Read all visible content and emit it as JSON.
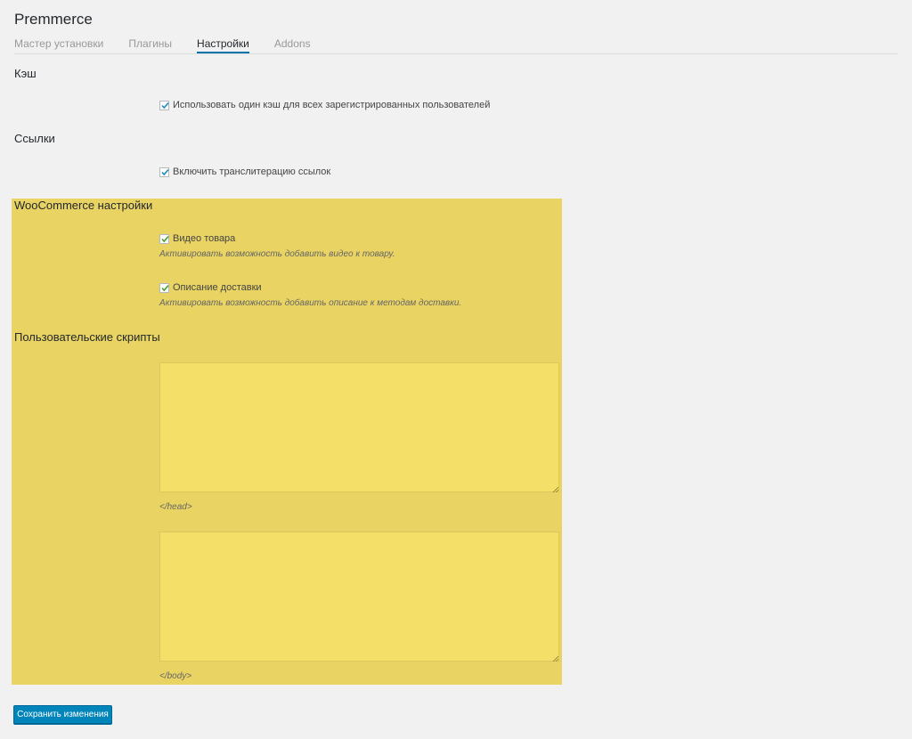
{
  "app": {
    "title": "Premmerce"
  },
  "tabs": [
    {
      "label": "Мастер установки",
      "active": false
    },
    {
      "label": "Плагины",
      "active": false
    },
    {
      "label": "Настройки",
      "active": true
    },
    {
      "label": "Addons",
      "active": false
    }
  ],
  "cache": {
    "title": "Кэш",
    "checkbox_label": "Использовать один кэш для всех зарегистрированных пользователей",
    "checked": true
  },
  "links": {
    "title": "Ссылки",
    "checkbox_label": "Включить транслитерацию ссылок",
    "checked": true
  },
  "woocommerce": {
    "title": "WooCommerce настройки",
    "video": {
      "label": "Видео товара",
      "description": "Активировать возможность добавить видео к товару.",
      "checked": true
    },
    "delivery": {
      "label": "Описание доставки",
      "description": "Активировать возможность добавить описание к методам доставки.",
      "checked": true
    }
  },
  "scripts": {
    "title": "Пользовательские скрипты",
    "head_value": "",
    "head_hint": "</head>",
    "body_value": "",
    "body_hint": "</body>"
  },
  "footer": {
    "save_label": "Сохранить изменения"
  },
  "colors": {
    "accent": "#0073aa",
    "button": "#0085ba",
    "highlight": "#e8d363",
    "textarea_bg": "#f4e068"
  }
}
